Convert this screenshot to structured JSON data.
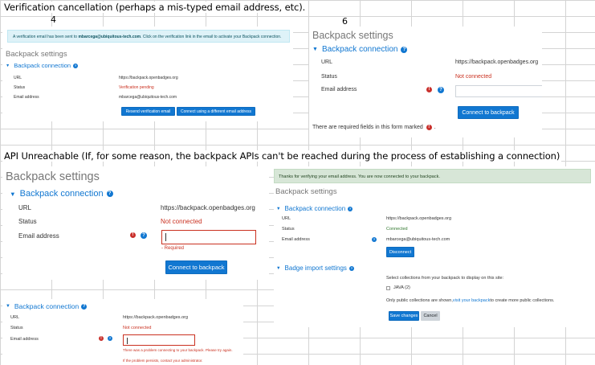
{
  "sheet": {
    "heading_top": "Verification cancellation (perhaps a mis-typed email address, etc).",
    "heading_api": "API Unreachable (If, for some reason, the backpack APIs can't be reached during the process of establishing a connection)",
    "cell_4": "4",
    "cell_6": "6"
  },
  "shot4": {
    "alert_prefix": "A verification email has been sent to ",
    "alert_email": "mbarcega@ubiquitous-tech.com",
    "alert_suffix": ". Click on the verification link in the email to activate your Backpack connection.",
    "page_title": "Backpack settings",
    "legend": "Backpack connection",
    "url_label": "URL",
    "url_value": "https://backpack.openbadges.org",
    "status_label": "Status",
    "status_value": "Verification pending",
    "email_label": "Email address",
    "email_value": "mbarcega@ubiquitous-tech.com",
    "resend_button": "Resend verification email",
    "different_email_button": "Connect using a different email address"
  },
  "shot6": {
    "page_title": "Backpack settings",
    "legend": "Backpack connection",
    "url_label": "URL",
    "url_value": "https://backpack.openbadges.org",
    "status_label": "Status",
    "status_value": "Not connected",
    "email_label": "Email address",
    "email_value": "",
    "connect_button": "Connect to backpack",
    "required_note": "There are required fields in this form marked"
  },
  "shotApi": {
    "page_title": "Backpack settings",
    "legend": "Backpack connection",
    "url_label": "URL",
    "url_value": "https://backpack.openbadges.org",
    "status_label": "Status",
    "status_value": "Not connected",
    "email_label": "Email address",
    "email_value": "",
    "required_error": "- Required",
    "connect_button": "Connect to backpack"
  },
  "shotConnected": {
    "alert": "Thanks for verifying your email address. You are now connected to your backpack.",
    "page_title": "Backpack settings",
    "legend": "Backpack connection",
    "url_label": "URL",
    "url_value": "https://backpack.openbadges.org",
    "status_label": "Status",
    "status_value": "Connected",
    "email_label": "Email address",
    "email_value": "mbarcega@ubiquitous-tech.com",
    "disconnect_button": "Disconnect",
    "import_legend": "Badge import settings",
    "collections_intro": "Select collections from your backpack to display on this site:",
    "collection_item": "JAVA (2)",
    "public_note_prefix": "Only public collections are shown, ",
    "public_note_link": "visit your backpack",
    "public_note_suffix": " to create more public collections.",
    "save_button": "Save changes",
    "cancel_button": "Cancel"
  },
  "shotError": {
    "legend": "Backpack connection",
    "url_label": "URL",
    "url_value": "https://backpack.openbadges.org",
    "status_label": "Status",
    "status_value": "Not connected",
    "email_label": "Email address",
    "email_value": "",
    "error_line1": "There was a problem connecting to your backpack. Please try again.",
    "error_line2": "If the problem persists, contact your administrator."
  }
}
